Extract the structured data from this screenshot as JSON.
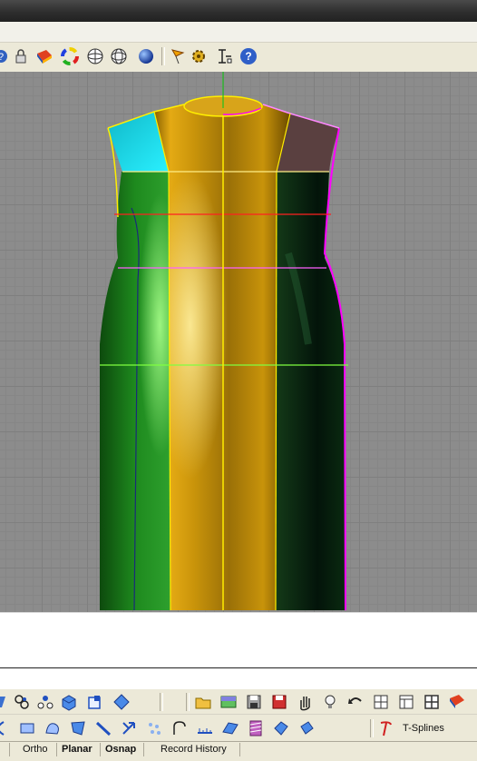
{
  "toolbar_icons": [
    "help-partial-icon",
    "lock-icon",
    "material-icon",
    "color-wheel-icon",
    "wireframe-sphere-icon",
    "grid-sphere-icon",
    "rendered-sphere-icon",
    "flag-icon",
    "gear-icon",
    "dimension-icon",
    "help-icon"
  ],
  "viewport": {
    "model": "dress-surface",
    "colors": {
      "front": "#c8930a",
      "left": "#1e8a1e",
      "right": "#0a2a10",
      "cyan_panel": "#15d9e6",
      "brown_panel": "#5a4040",
      "highlight_yellow": "#ffee00",
      "highlight_magenta": "#ff00ff"
    }
  },
  "bottom_toolbar_1_icons": [
    "sphere-points-icon",
    "points-icon",
    "box-blue-icon",
    "square-icon",
    "diamond-icon",
    "open-folder-icon",
    "image-icon",
    "save-icon",
    "save-red-icon",
    "pan-hand-icon",
    "bulb-icon",
    "undo-icon",
    "grid-snap-icon",
    "layout-icon",
    "four-viewports-icon",
    "material-red-icon"
  ],
  "bottom_toolbar_2_icons": [
    "curve-icon",
    "rect-icon",
    "shape-icon",
    "polygon-icon",
    "line-icon",
    "arrows-icon",
    "scatter-icon",
    "arc-icon",
    "ruler-icon",
    "plane-icon",
    "striped-icon",
    "surface-icon",
    "solid-icon"
  ],
  "tsplines": {
    "label": "T-Splines toolbars"
  },
  "status": {
    "ortho": "Ortho",
    "planar": "Planar",
    "osnap": "Osnap",
    "record_history": "Record History"
  }
}
